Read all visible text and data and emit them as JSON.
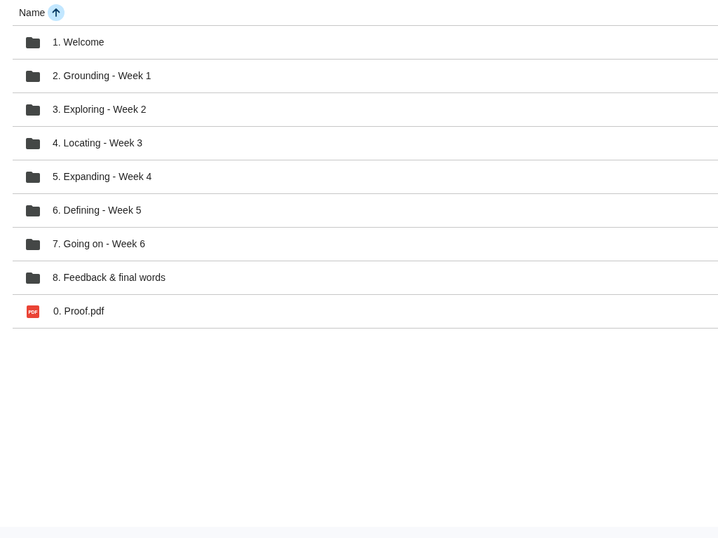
{
  "header": {
    "label": "Name",
    "sort_ascending": true
  },
  "items": [
    {
      "kind": "folder",
      "name": "1. Welcome"
    },
    {
      "kind": "folder",
      "name": "2. Grounding - Week 1"
    },
    {
      "kind": "folder",
      "name": "3. Exploring - Week 2"
    },
    {
      "kind": "folder",
      "name": "4. Locating - Week 3"
    },
    {
      "kind": "folder",
      "name": "5. Expanding - Week 4"
    },
    {
      "kind": "folder",
      "name": "6. Defining - Week 5"
    },
    {
      "kind": "folder",
      "name": "7. Going on - Week 6"
    },
    {
      "kind": "folder",
      "name": "8. Feedback & final words"
    },
    {
      "kind": "pdf",
      "name": "0. Proof.pdf",
      "icon_text": "PDF"
    }
  ]
}
